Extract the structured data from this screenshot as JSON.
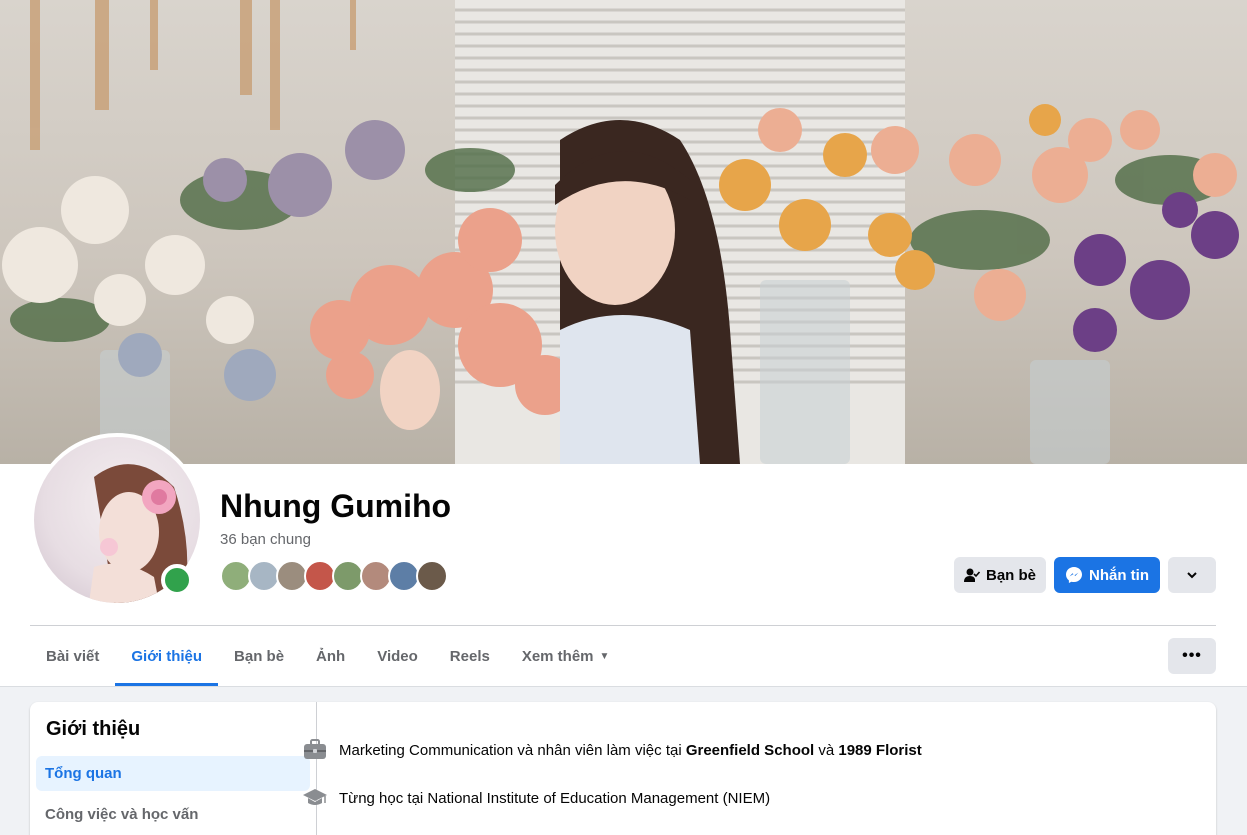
{
  "profile": {
    "name": "Nhung Gumiho",
    "mutual_friends_text": "36 bạn chung",
    "mutual_friend_avatars": [
      "#8fae7a",
      "#a7b6c4",
      "#9b8d7e",
      "#c4564a",
      "#7d9a6a",
      "#b38a7c",
      "#5d7ea6",
      "#6b5a4a"
    ]
  },
  "actions": {
    "friends_label": "Bạn bè",
    "message_label": "Nhắn tin"
  },
  "tabs": [
    {
      "label": "Bài viết"
    },
    {
      "label": "Giới thiệu"
    },
    {
      "label": "Bạn bè"
    },
    {
      "label": "Ảnh"
    },
    {
      "label": "Video"
    },
    {
      "label": "Reels"
    },
    {
      "label": "Xem thêm"
    }
  ],
  "about": {
    "title": "Giới thiệu",
    "nav": [
      {
        "label": "Tổng quan"
      },
      {
        "label": "Công việc và học vấn"
      }
    ],
    "work": {
      "prefix": "Marketing Communication và nhân viên làm việc tại ",
      "place1": "Greenfield School",
      "joiner": " và ",
      "place2": "1989 Florist"
    },
    "education": {
      "text": "Từng học tại National Institute of Education Management (NIEM)"
    }
  },
  "colors": {
    "accent": "#1b74e4",
    "online": "#31a24c"
  }
}
